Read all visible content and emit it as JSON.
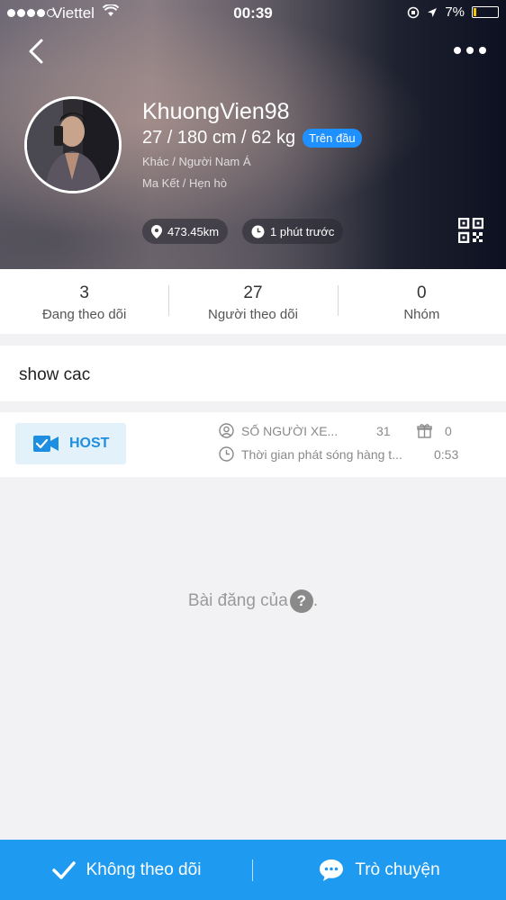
{
  "status_bar": {
    "carrier": "Viettel",
    "time": "00:39",
    "battery": "7%"
  },
  "profile": {
    "username": "KhuongVien98",
    "stats": "27 / 180 cm / 62 kg",
    "badge": "Trên đầu",
    "tags": "Khác / Người Nam Á",
    "tags2": "Ma Kết  / Hẹn hò",
    "distance": "473.45km",
    "last_active": "1 phút trước"
  },
  "follow_stats": [
    {
      "value": "3",
      "label": "Đang theo dõi"
    },
    {
      "value": "27",
      "label": "Người theo dõi"
    },
    {
      "value": "0",
      "label": "Nhóm"
    }
  ],
  "bio": "show cac",
  "live": {
    "host_label": "HOST",
    "viewers_label": "SỐ NGƯỜI XE...",
    "viewers_value": "31",
    "gifts_value": "0",
    "duration_label": "Thời gian phát sóng hàng t...",
    "duration_value": "0:53"
  },
  "posts": {
    "empty_text": "Bài đăng của",
    "empty_suffix": "."
  },
  "bottom_bar": {
    "unfollow_label": "Không theo dõi",
    "chat_label": "Trò chuyện"
  },
  "colors": {
    "accent": "#1e9af0",
    "badge": "#1e90ff",
    "host_bg": "#e3f1fb"
  }
}
